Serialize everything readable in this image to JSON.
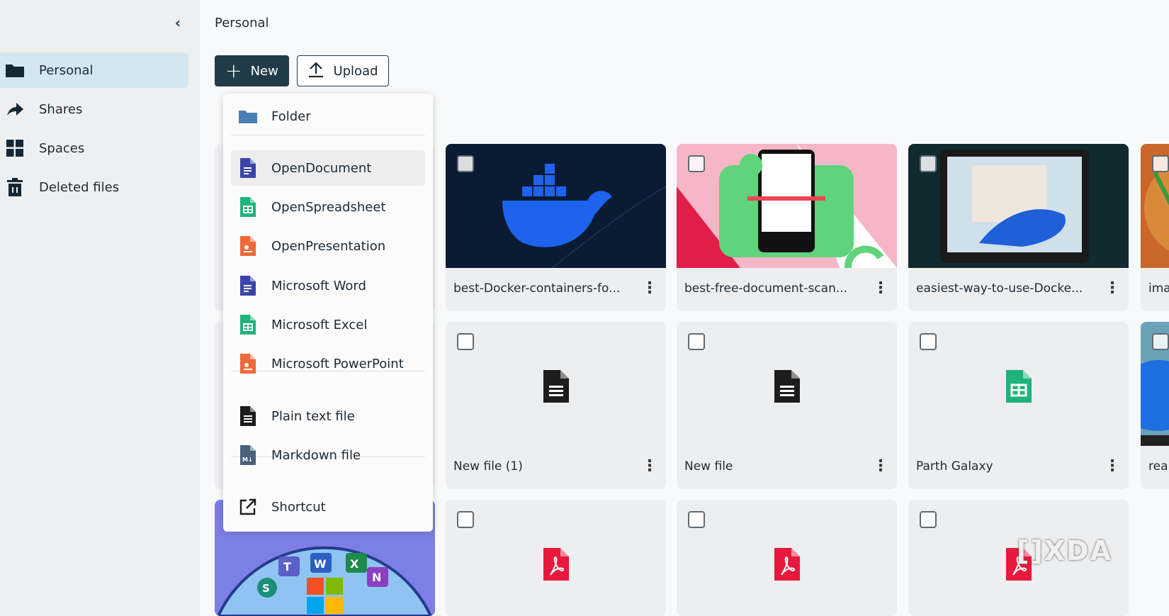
{
  "sidebar": {
    "items": [
      {
        "label": "Personal",
        "icon": "folder-icon",
        "active": true
      },
      {
        "label": "Shares",
        "icon": "share-arrow-icon"
      },
      {
        "label": "Spaces",
        "icon": "grid-icon"
      },
      {
        "label": "Deleted files",
        "icon": "trash-icon"
      }
    ]
  },
  "breadcrumb": "Personal",
  "toolbar": {
    "new_label": "New",
    "upload_label": "Upload"
  },
  "new_menu": {
    "items": [
      {
        "label": "Folder",
        "icon": "folder-icon",
        "color": "#4a7fb5"
      },
      {
        "label": "OpenDocument",
        "icon": "document-icon",
        "color": "#3b45a8"
      },
      {
        "label": "OpenSpreadsheet",
        "icon": "spreadsheet-icon",
        "color": "#1fb37a"
      },
      {
        "label": "OpenPresentation",
        "icon": "presentation-icon",
        "color": "#ee6a3a"
      },
      {
        "label": "Microsoft Word",
        "icon": "document-icon",
        "color": "#3b45a8"
      },
      {
        "label": "Microsoft Excel",
        "icon": "spreadsheet-icon",
        "color": "#1fb37a"
      },
      {
        "label": "Microsoft PowerPoint",
        "icon": "presentation-icon",
        "color": "#ee6a3a"
      },
      {
        "label": "Plain text file",
        "icon": "text-file-icon",
        "color": "#1d1d1d"
      },
      {
        "label": "Markdown file",
        "icon": "markdown-file-icon",
        "color": "#4a6079"
      },
      {
        "label": "Shortcut",
        "icon": "external-link-icon",
        "color": "#1d1d1d"
      }
    ]
  },
  "files": [
    {
      "name": "best-Docker-containers-fo...",
      "type": "image",
      "thumb": "docker"
    },
    {
      "name": "best-free-document-scan...",
      "type": "image",
      "thumb": "scanner"
    },
    {
      "name": "easiest-way-to-use-Docke...",
      "type": "image",
      "thumb": "laptop"
    },
    {
      "name": "ima",
      "type": "image",
      "thumb": "food"
    },
    {
      "name": "New file (1)",
      "type": "text"
    },
    {
      "name": "New file",
      "type": "text"
    },
    {
      "name": "Parth Galaxy",
      "type": "spreadsheet"
    },
    {
      "name": "rea",
      "type": "image",
      "thumb": "windows"
    },
    {
      "name": "",
      "type": "image",
      "thumb": "office"
    },
    {
      "name": "",
      "type": "pdf"
    },
    {
      "name": "",
      "type": "pdf"
    },
    {
      "name": "",
      "type": "pdf"
    }
  ],
  "watermark": "XDA",
  "colors": {
    "accent": "#223b48",
    "active_nav": "#d4e7f1",
    "pdf": "#e8193c"
  }
}
